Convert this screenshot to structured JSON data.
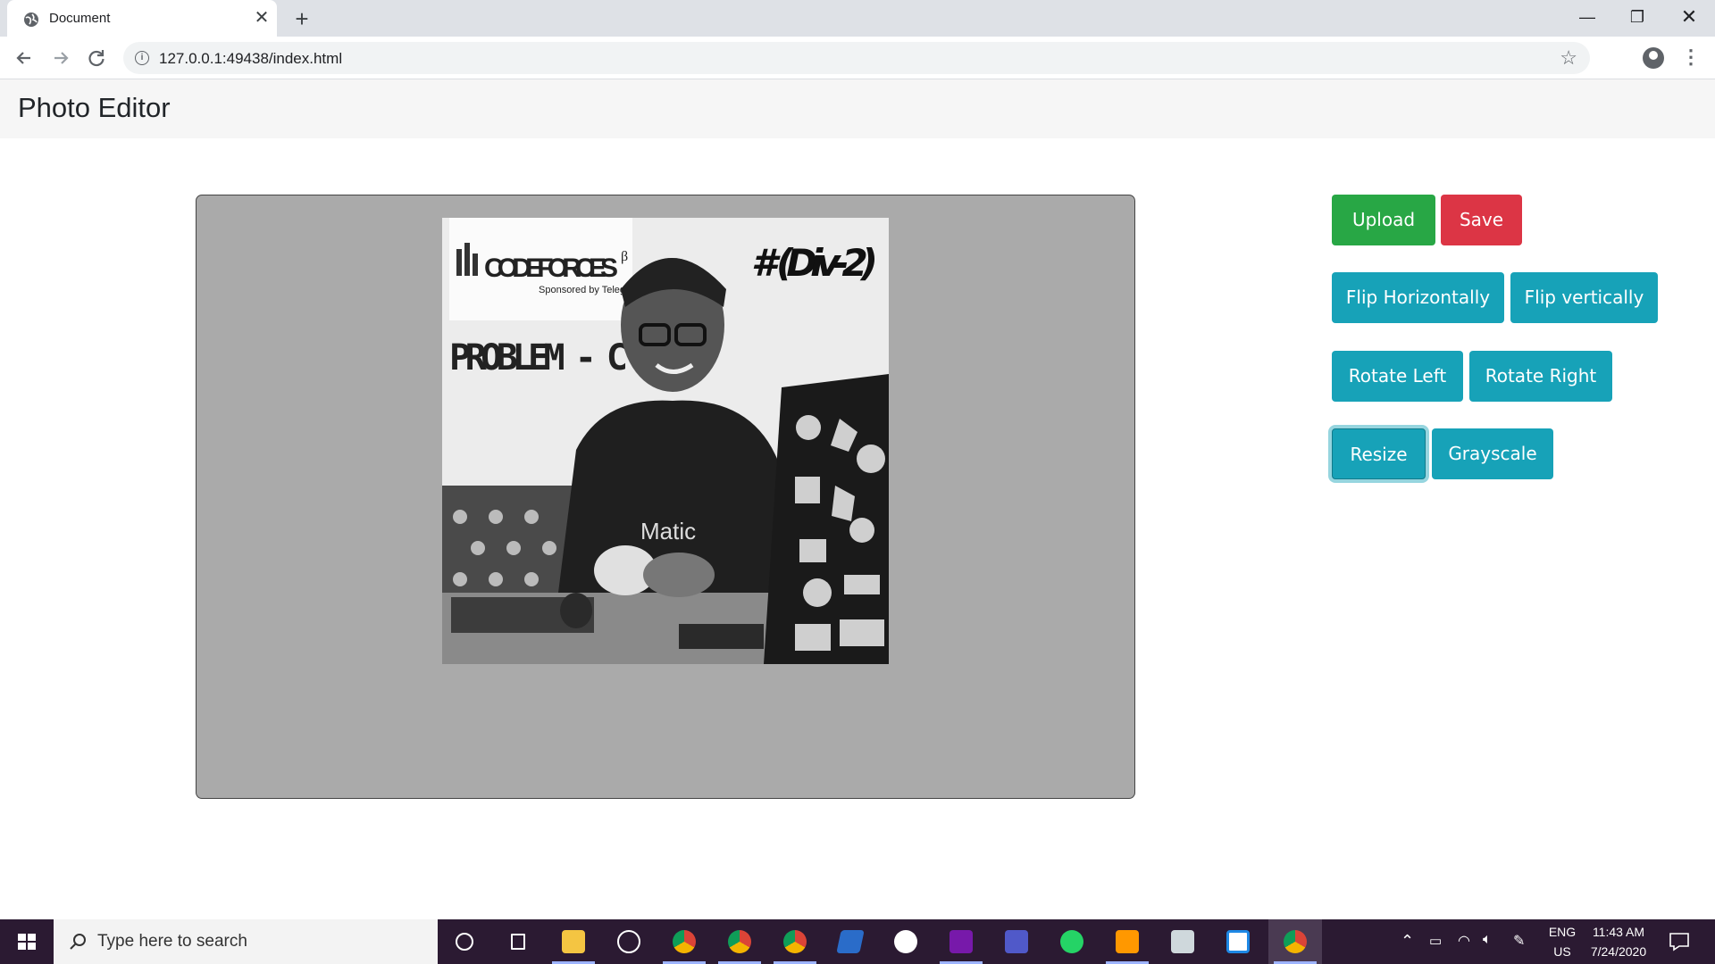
{
  "browser": {
    "tab_title": "Document",
    "tab_close": "✕",
    "new_tab": "+",
    "url": "127.0.0.1:49438/index.html",
    "window_controls": {
      "minimize": "—",
      "maximize": "❐",
      "close": "✕"
    }
  },
  "page": {
    "brand": "Photo Editor"
  },
  "photo": {
    "logo": "CODEFORCES",
    "logo_sup": "β",
    "logo_sub": "Sponsored by Telegram",
    "div_text": "# (Div-2)",
    "problem_text": "PROBLEM - C",
    "shirt_text": "Matic"
  },
  "buttons": {
    "upload": "Upload",
    "save": "Save",
    "flip_horizontally": "Flip Horizontally",
    "flip_vertically": "Flip vertically",
    "rotate_left": "Rotate Left",
    "rotate_right": "Rotate Right",
    "resize": "Resize",
    "grayscale": "Grayscale"
  },
  "colors": {
    "success": "#28a745",
    "danger": "#dc3545",
    "info": "#17a2b8",
    "canvas": "#aaaaaa",
    "navbar": "#f6f6f6",
    "taskbar": "#2b1a32"
  },
  "taskbar": {
    "search_placeholder": "Type here to search",
    "apps": [
      "cortana-icon",
      "task-view-icon",
      "file-explorer-icon",
      "obs-icon",
      "chrome-icon",
      "chrome-icon",
      "chrome-icon",
      "powershell-icon",
      "mountain-icon",
      "onenote-icon",
      "teams-icon",
      "whatsapp-icon",
      "sublime-icon",
      "app-icon",
      "app-icon",
      "chrome-icon"
    ],
    "language": "ENG",
    "region": "US",
    "time": "11:43 AM",
    "date": "7/24/2020"
  }
}
